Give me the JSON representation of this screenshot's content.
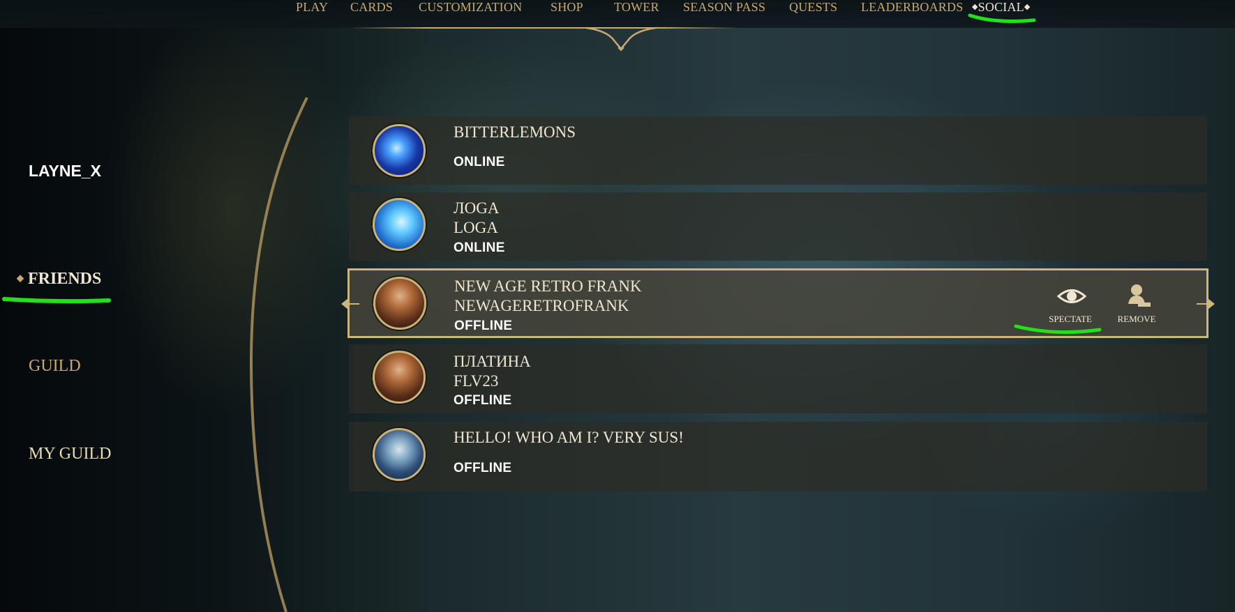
{
  "nav": {
    "items": [
      "PLAY",
      "CARDS",
      "CUSTOMIZATION",
      "SHOP",
      "TOWER",
      "SEASON PASS",
      "QUESTS",
      "LEADERBOARDS"
    ],
    "active": "SOCIAL"
  },
  "sidebar": {
    "username": "LAYNE_X",
    "friends": "FRIENDS",
    "guild": "GUILD",
    "my_guild": "MY GUILD"
  },
  "friends": [
    {
      "name": "BITTERLEMONS",
      "tag": "",
      "status": "ONLINE",
      "avatar": "blue-rune-avatar"
    },
    {
      "name": "ЛОGA",
      "tag": "LOGA",
      "status": "ONLINE",
      "avatar": "blue-lion-avatar"
    },
    {
      "name": "NEW AGE RETRO FRANK",
      "tag": "NEWAGERETROFRANK",
      "status": "OFFLINE",
      "avatar": "warrior-avatar"
    },
    {
      "name": "ПЛАТИНА",
      "tag": "FLV23",
      "status": "OFFLINE",
      "avatar": "warrior-avatar"
    },
    {
      "name": "HELLO! WHO AM I? VERY SUS!",
      "tag": "",
      "status": "OFFLINE",
      "avatar": "robot-avatar"
    }
  ],
  "selected_actions": {
    "spectate": "SPECTATE",
    "remove": "REMOVE"
  },
  "colors": {
    "gold": "#c8aa6e",
    "cream": "#f0e6d2",
    "highlight_annotation": "#22e01a"
  }
}
